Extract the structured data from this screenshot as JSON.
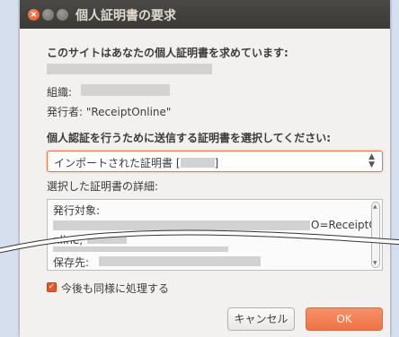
{
  "window": {
    "title": "個人証明書の要求"
  },
  "dialog": {
    "heading": "このサイトはあなたの個人証明書を求めています:",
    "org_label": "組織:",
    "issuer_label": "発行者: \"ReceiptOnline\"",
    "select_prompt": "個人認証を行うために送信する証明書を選択してください:",
    "combo_value": "インポートされた証明書 [",
    "combo_suffix": "]",
    "details_label": "選択した証明書の詳細:",
    "details": {
      "issued_to_label": "発行対象:",
      "org_fragment": "O=ReceiptO",
      "org_fragment_cont": "nline,",
      "stored_in_label": "保存先:"
    },
    "remember_label": "今後も同様に処理する",
    "remember_checked": true,
    "cancel_label": "キャンセル",
    "ok_label": "OK"
  },
  "colors": {
    "accent": "#ef7445",
    "titlebar": "#3c3b37",
    "dialog_bg": "#f2f1f0"
  }
}
